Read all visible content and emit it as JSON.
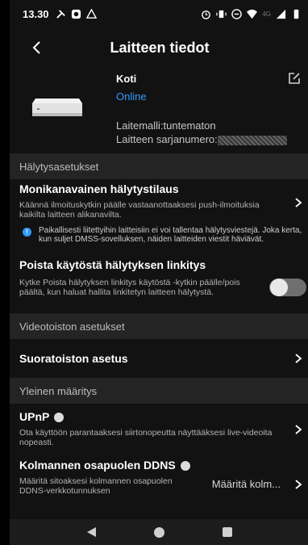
{
  "status_bar": {
    "time": "13.30",
    "network_label": "4G"
  },
  "app_bar": {
    "title": "Laitteen tiedot"
  },
  "device": {
    "name": "Koti",
    "status": "Online",
    "model": "Laitemalli:tuntematon",
    "serial_label": "Laitteen sarjanumero:"
  },
  "sections": {
    "alarm": {
      "header": "Hälytysasetukset",
      "multichannel_title": "Monikanavainen hälytystilaus",
      "multichannel_desc": "Käännä ilmoituskytkin päälle vastaanottaaksesi push-ilmoituksia kaikilta laitteen alikanavilta.",
      "notice": "Paikallisesti liitettyihin laitteisiin ei voi tallentaa hälytysviestejä. Joka kerta, kun suljet DMSS-sovelluksen, näiden laitteiden viestit häviävät.",
      "disable_link_title": "Poista käytöstä hälytyksen linkitys",
      "disable_link_desc": "Kytke Poista hälytyksen linkitys käytöstä -kytkin päälle/pois päältä, kun haluat hallita linkitetyn laitteen hälytystä.",
      "disable_link_on": false
    },
    "playback": {
      "header": "Videotoiston asetukset",
      "stream_title": "Suoratoiston asetus"
    },
    "general": {
      "header": "Yleinen määritys",
      "upnp_title": "UPnP",
      "upnp_desc": "Ota käyttöön parantaaksesi siirtonopeutta näyttääksesi live-videoita nopeasti.",
      "ddns_title": "Kolmannen osapuolen DDNS",
      "ddns_desc": "Määritä sitoaksesi kolmannen osapuolen DDNS-verkkotunnuksen",
      "ddns_value": "Määritä kolm..."
    }
  },
  "colors": {
    "accent": "#2f9bff",
    "background": "#121212",
    "section_bg": "#242424"
  }
}
